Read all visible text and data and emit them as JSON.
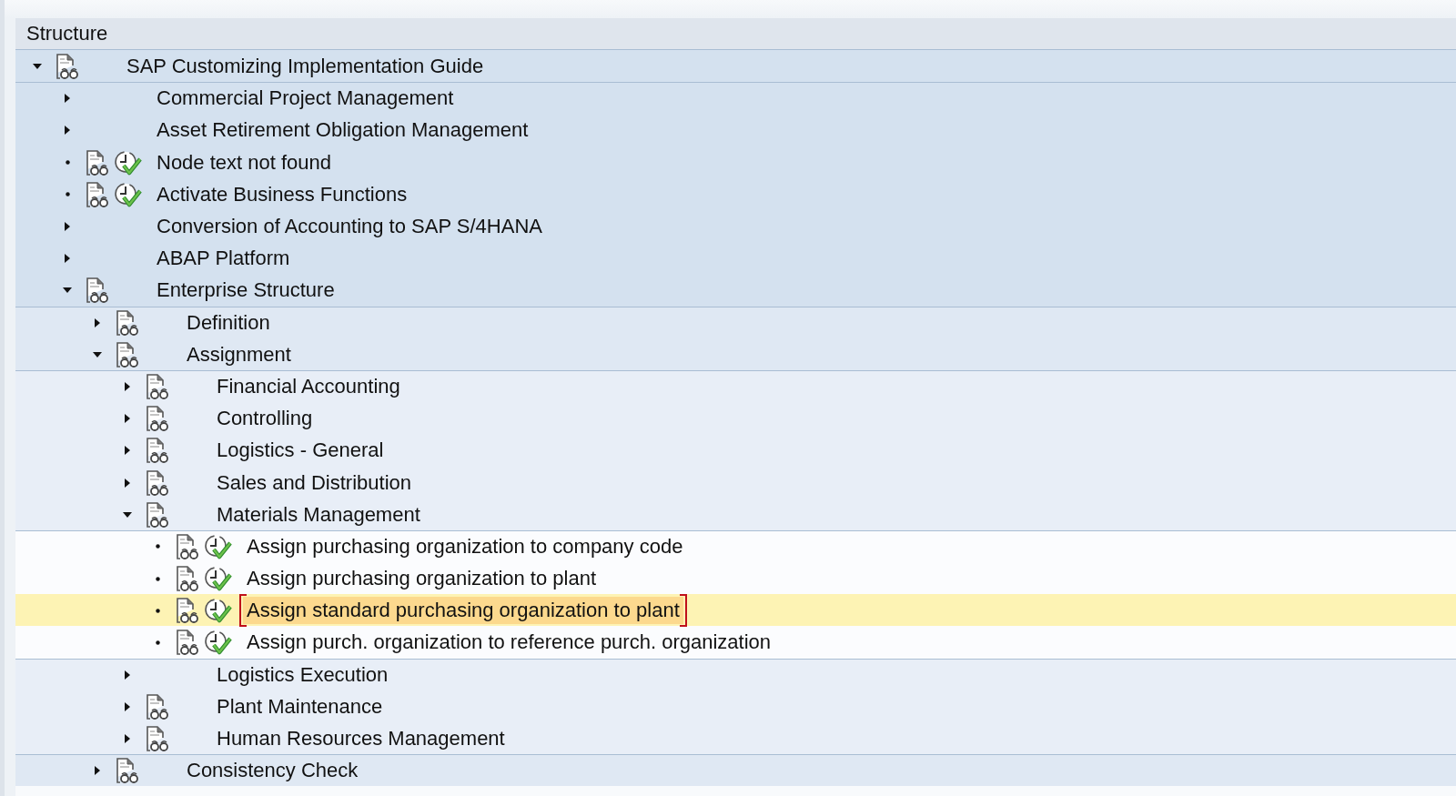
{
  "header": {
    "title": "Structure"
  },
  "tree": [
    {
      "label": "SAP Customizing Implementation Guide",
      "kind": "node",
      "expanded": true,
      "documentation": true,
      "selected": false,
      "children": [
        {
          "label": "Commercial Project Management",
          "kind": "node",
          "expanded": false,
          "documentation": false,
          "selected": false
        },
        {
          "label": "Asset Retirement Obligation Management",
          "kind": "node",
          "expanded": false,
          "documentation": false,
          "selected": false
        },
        {
          "label": "Node text not found",
          "kind": "leaf",
          "documentation": true,
          "selected": false
        },
        {
          "label": "Activate Business Functions",
          "kind": "leaf",
          "documentation": true,
          "selected": false
        },
        {
          "label": "Conversion of Accounting to SAP S/4HANA",
          "kind": "node",
          "expanded": false,
          "documentation": false,
          "selected": false
        },
        {
          "label": "ABAP Platform",
          "kind": "node",
          "expanded": false,
          "documentation": false,
          "selected": false
        },
        {
          "label": "Enterprise Structure",
          "kind": "node",
          "expanded": true,
          "documentation": true,
          "selected": false,
          "children": [
            {
              "label": "Definition",
              "kind": "node",
              "expanded": false,
              "documentation": true,
              "selected": false
            },
            {
              "label": "Assignment",
              "kind": "node",
              "expanded": true,
              "documentation": true,
              "selected": false,
              "children": [
                {
                  "label": "Financial Accounting",
                  "kind": "node",
                  "expanded": false,
                  "documentation": true,
                  "selected": false
                },
                {
                  "label": "Controlling",
                  "kind": "node",
                  "expanded": false,
                  "documentation": true,
                  "selected": false
                },
                {
                  "label": "Logistics - General",
                  "kind": "node",
                  "expanded": false,
                  "documentation": true,
                  "selected": false
                },
                {
                  "label": "Sales and Distribution",
                  "kind": "node",
                  "expanded": false,
                  "documentation": true,
                  "selected": false
                },
                {
                  "label": "Materials Management",
                  "kind": "node",
                  "expanded": true,
                  "documentation": true,
                  "selected": false,
                  "children": [
                    {
                      "label": "Assign purchasing organization to company code",
                      "kind": "leaf",
                      "documentation": true,
                      "selected": false
                    },
                    {
                      "label": "Assign purchasing organization to plant",
                      "kind": "leaf",
                      "documentation": true,
                      "selected": false
                    },
                    {
                      "label": "Assign standard purchasing organization to plant",
                      "kind": "leaf",
                      "documentation": true,
                      "selected": true
                    },
                    {
                      "label": "Assign purch. organization to reference purch. organization",
                      "kind": "leaf",
                      "documentation": true,
                      "selected": false
                    }
                  ]
                },
                {
                  "label": "Logistics Execution",
                  "kind": "node",
                  "expanded": false,
                  "documentation": false,
                  "selected": false
                },
                {
                  "label": "Plant Maintenance",
                  "kind": "node",
                  "expanded": false,
                  "documentation": true,
                  "selected": false
                },
                {
                  "label": "Human Resources Management",
                  "kind": "node",
                  "expanded": false,
                  "documentation": true,
                  "selected": false
                }
              ]
            },
            {
              "label": "Consistency Check",
              "kind": "node",
              "expanded": false,
              "documentation": true,
              "selected": false
            }
          ]
        }
      ]
    }
  ]
}
